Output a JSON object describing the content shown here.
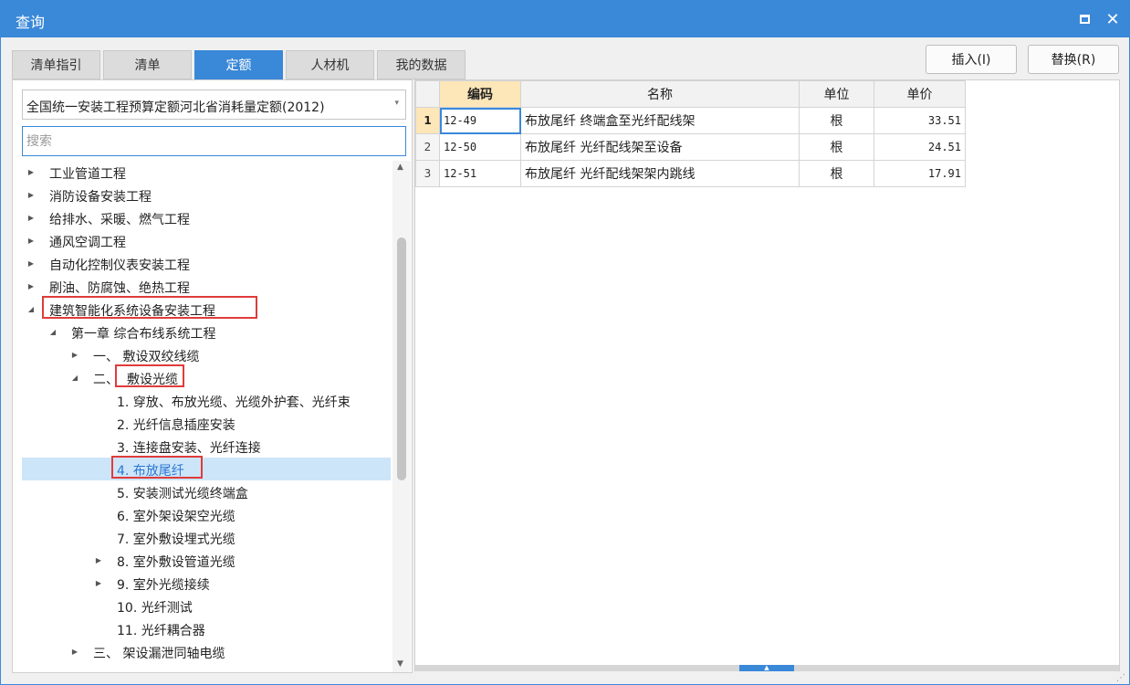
{
  "window": {
    "title": "查询",
    "close_glyph": "✕"
  },
  "colors": {
    "accent": "#3a88d8",
    "highlight_box": "#e03b3b",
    "selected_row": "#cde5f8",
    "active_header": "#fde6b8"
  },
  "tabs": [
    {
      "label": "清单指引",
      "active": false
    },
    {
      "label": "清单",
      "active": false
    },
    {
      "label": "定额",
      "active": true
    },
    {
      "label": "人材机",
      "active": false
    },
    {
      "label": "我的数据",
      "active": false
    }
  ],
  "actions": {
    "insert_label": "插入(I)",
    "replace_label": "替换(R)"
  },
  "library_select": {
    "value": "全国统一安装工程预算定额河北省消耗量定额(2012)",
    "arrow_glyph": "▾"
  },
  "search": {
    "placeholder": "搜索",
    "value": ""
  },
  "tree": {
    "expand_glyph": "▶",
    "collapse_glyph": "◢",
    "items": [
      {
        "label": "工业管道工程",
        "state": "collapsed",
        "level": 0
      },
      {
        "label": "消防设备安装工程",
        "state": "collapsed",
        "level": 0
      },
      {
        "label": "给排水、采暖、燃气工程",
        "state": "collapsed",
        "level": 0
      },
      {
        "label": "通风空调工程",
        "state": "collapsed",
        "level": 0
      },
      {
        "label": "自动化控制仪表安装工程",
        "state": "collapsed",
        "level": 0
      },
      {
        "label": "刷油、防腐蚀、绝热工程",
        "state": "collapsed",
        "level": 0
      },
      {
        "label": "建筑智能化系统设备安装工程",
        "state": "expanded",
        "level": 0,
        "highlighted": true
      },
      {
        "label": "第一章 综合布线系统工程",
        "state": "expanded",
        "level": 1
      },
      {
        "label": "一、  敷设双绞线缆",
        "state": "collapsed",
        "level": 2
      },
      {
        "label": "二、",
        "label_rest": "敷设光缆",
        "state": "expanded",
        "level": 2,
        "highlighted": true
      },
      {
        "label": "1. 穿放、布放光缆、光缆外护套、光纤束",
        "state": "leaf",
        "level": 3
      },
      {
        "label": "2. 光纤信息插座安装",
        "state": "leaf",
        "level": 3
      },
      {
        "label": "3. 连接盘安装、光纤连接",
        "state": "leaf",
        "level": 3
      },
      {
        "label": "4. 布放尾纤",
        "state": "leaf",
        "level": 3,
        "selected": true,
        "highlighted": true
      },
      {
        "label": "5. 安装测试光缆终端盒",
        "state": "leaf",
        "level": 3
      },
      {
        "label": "6. 室外架设架空光缆",
        "state": "leaf",
        "level": 3
      },
      {
        "label": "7. 室外敷设埋式光缆",
        "state": "leaf",
        "level": 3
      },
      {
        "label": "8. 室外敷设管道光缆",
        "state": "collapsed",
        "level": 3
      },
      {
        "label": "9. 室外光缆接续",
        "state": "collapsed",
        "level": 3
      },
      {
        "label": "10. 光纤测试",
        "state": "leaf",
        "level": 3
      },
      {
        "label": "11. 光纤耦合器",
        "state": "leaf",
        "level": 3
      },
      {
        "label": "三、  架设漏泄同轴电缆",
        "state": "collapsed",
        "level": 2
      }
    ]
  },
  "grid": {
    "columns": [
      "编码",
      "名称",
      "单位",
      "单价"
    ],
    "rows": [
      {
        "no": "1",
        "code": "12-49",
        "name": "布放尾纤 终端盒至光纤配线架",
        "unit": "根",
        "price": "33.51"
      },
      {
        "no": "2",
        "code": "12-50",
        "name": "布放尾纤 光纤配线架至设备",
        "unit": "根",
        "price": "24.51"
      },
      {
        "no": "3",
        "code": "12-51",
        "name": "布放尾纤 光纤配线架架内跳线",
        "unit": "根",
        "price": "17.91"
      }
    ]
  }
}
